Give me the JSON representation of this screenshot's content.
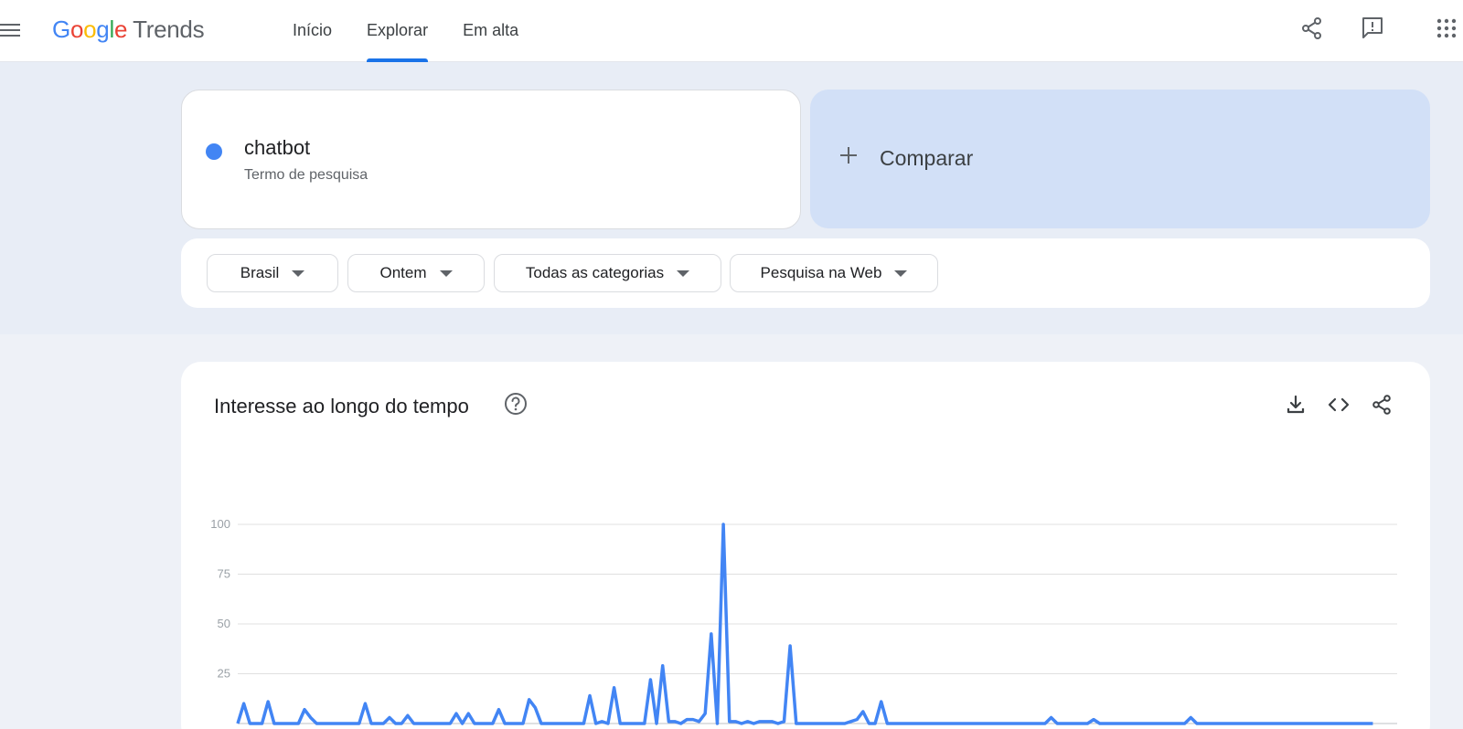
{
  "app": {
    "logo_google": "Google",
    "logo_trends": "Trends",
    "colors": {
      "blue": "#4285f4",
      "red": "#ea4335",
      "yellow": "#fbbc05",
      "green": "#34a853"
    }
  },
  "header": {
    "tabs": [
      {
        "label": "Início",
        "active": false
      },
      {
        "label": "Explorar",
        "active": true
      },
      {
        "label": "Em alta",
        "active": false
      }
    ],
    "icons": [
      "menu-icon",
      "share-icon",
      "feedback-icon",
      "apps-icon"
    ]
  },
  "search": {
    "term": "chatbot",
    "term_type": "Termo de pesquisa",
    "term_color": "#4285f4",
    "compare_label": "Comparar"
  },
  "filters": [
    {
      "label": "Brasil"
    },
    {
      "label": "Ontem"
    },
    {
      "label": "Todas as categorias"
    },
    {
      "label": "Pesquisa na Web"
    }
  ],
  "interest": {
    "title": "Interesse ao longo do tempo",
    "icons": [
      "help-icon",
      "download-icon",
      "embed-icon",
      "share-icon"
    ]
  },
  "chart_data": {
    "type": "line",
    "x": [
      0,
      1,
      2,
      3,
      4,
      5,
      6,
      7,
      8,
      9,
      10,
      11,
      12,
      13,
      14,
      15,
      16,
      17,
      18,
      19,
      20,
      21,
      22,
      23,
      24,
      25,
      26,
      27,
      28,
      29,
      30,
      31,
      32,
      33,
      34,
      35,
      36,
      37,
      38,
      39,
      40,
      41,
      42,
      43,
      44,
      45,
      46,
      47,
      48,
      49,
      50,
      51,
      52,
      53,
      54,
      55,
      56,
      57,
      58,
      59,
      60,
      61,
      62,
      63,
      64,
      65,
      66,
      67,
      68,
      69,
      70,
      71,
      72,
      73,
      74,
      75,
      76,
      77,
      78,
      79,
      80,
      81,
      82,
      83,
      84,
      85,
      86,
      87,
      88,
      89,
      90,
      91,
      92,
      93,
      94,
      95,
      96,
      97,
      98,
      99,
      100,
      101,
      102,
      103,
      104,
      105,
      106,
      107,
      108,
      109,
      110,
      111,
      112,
      113,
      114,
      115,
      116,
      117,
      118,
      119,
      120,
      121,
      122,
      123,
      124,
      125,
      126,
      127,
      128,
      129,
      130,
      131,
      132,
      133,
      134,
      135,
      136,
      137,
      138,
      139,
      140,
      141,
      142,
      143,
      144,
      145,
      146,
      147,
      148,
      149,
      150,
      151,
      152,
      153,
      154,
      155,
      156,
      157,
      158,
      159,
      160,
      161,
      162,
      163,
      164,
      165,
      166,
      167,
      168,
      169,
      170,
      171,
      172,
      173,
      174,
      175,
      176,
      177,
      178,
      179,
      180,
      181,
      182,
      183,
      184,
      185,
      186,
      187,
      188,
      189,
      190,
      191
    ],
    "series": [
      {
        "color": "#4285f4",
        "values": [
          0,
          10,
          0,
          0,
          0,
          11,
          0,
          0,
          0,
          0,
          0,
          7,
          3,
          0,
          0,
          0,
          0,
          0,
          0,
          0,
          0,
          10,
          0,
          0,
          0,
          3,
          0,
          0,
          4,
          0,
          0,
          0,
          0,
          0,
          0,
          0,
          5,
          0,
          5,
          0,
          0,
          0,
          0,
          7,
          0,
          0,
          0,
          0,
          12,
          8,
          0,
          0,
          0,
          0,
          0,
          0,
          0,
          0,
          14,
          0,
          1,
          0,
          18,
          0,
          0,
          0,
          0,
          0,
          22,
          0,
          29,
          1,
          1,
          0,
          2,
          2,
          1,
          5,
          45,
          0,
          100,
          1,
          1,
          0,
          1,
          0,
          1,
          1,
          1,
          0,
          1,
          39,
          0,
          0,
          0,
          0,
          0,
          0,
          0,
          0,
          0,
          1,
          2,
          6,
          0,
          0,
          11,
          0,
          0,
          0,
          0,
          0,
          0,
          0,
          0,
          0,
          0,
          0,
          0,
          0,
          0,
          0,
          0,
          0,
          0,
          0,
          0,
          0,
          0,
          0,
          0,
          0,
          0,
          0,
          3,
          0,
          0,
          0,
          0,
          0,
          0,
          2,
          0,
          0,
          0,
          0,
          0,
          0,
          0,
          0,
          0,
          0,
          0,
          0,
          0,
          0,
          0,
          3,
          0,
          0,
          0,
          0,
          0,
          0,
          0,
          0,
          0,
          0,
          0,
          0,
          0,
          0,
          0,
          0,
          0,
          0,
          0,
          0,
          0,
          0,
          0,
          0,
          0,
          0,
          0,
          0,
          0,
          0
        ]
      }
    ],
    "y_ticks": [
      "25",
      "50",
      "75",
      "100"
    ],
    "ylim": [
      0,
      100
    ],
    "grid": true
  }
}
